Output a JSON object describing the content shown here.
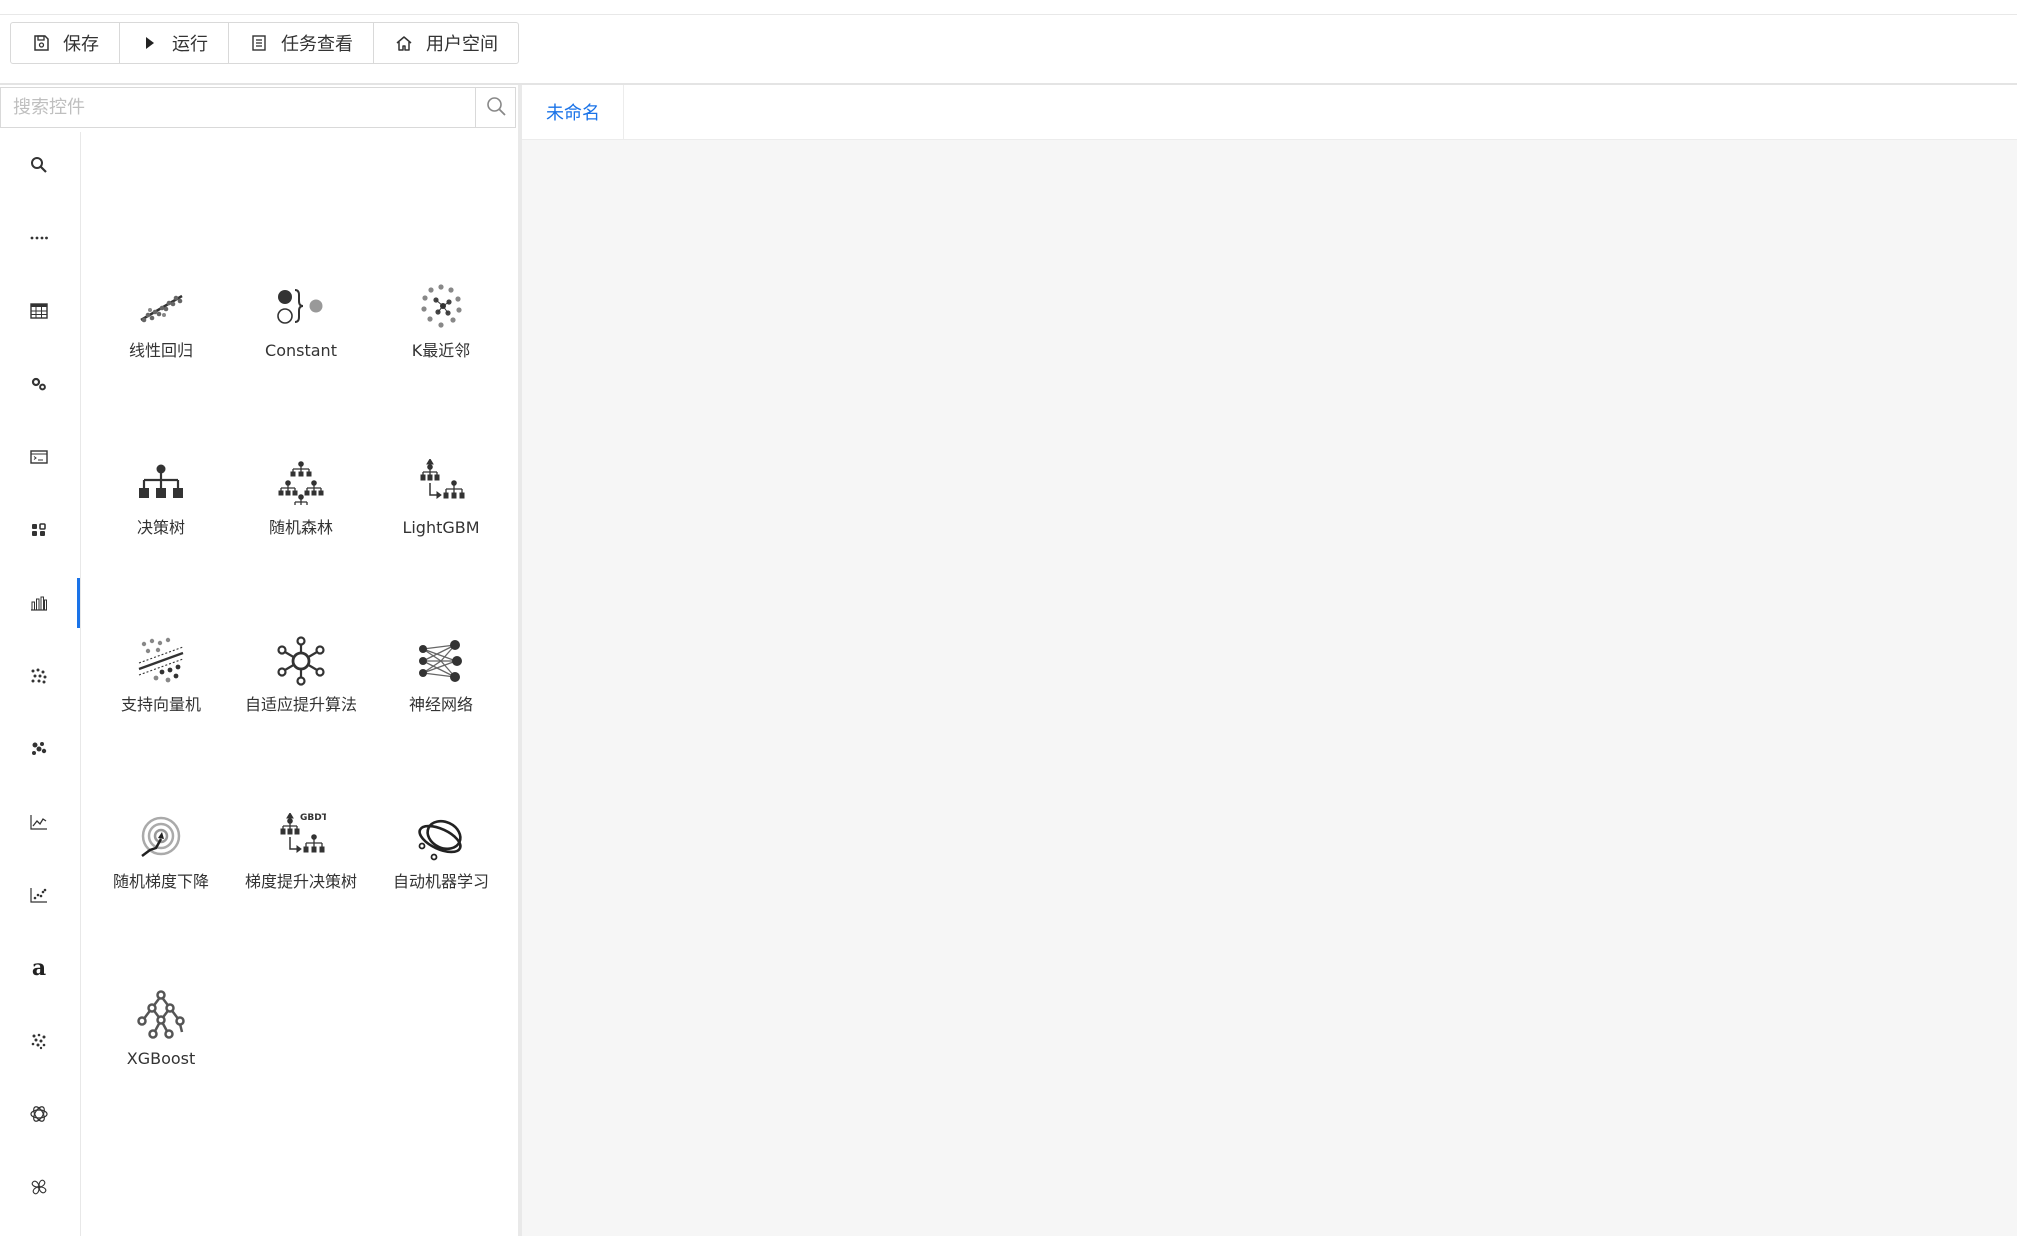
{
  "toolbar": {
    "buttons": [
      {
        "label": "保存",
        "icon": "save-icon"
      },
      {
        "label": "运行",
        "icon": "play-icon"
      },
      {
        "label": "任务查看",
        "icon": "task-list-icon"
      },
      {
        "label": "用户空间",
        "icon": "home-icon"
      }
    ]
  },
  "search": {
    "placeholder": "搜索控件",
    "value": ""
  },
  "categories": [
    "search-icon",
    "dots-icon",
    "table-icon",
    "gears-icon",
    "terminal-icon",
    "components-icon",
    "bar-chart-icon",
    "scatter-dots-icon",
    "cluster-icon",
    "line-chart-icon",
    "scatter-chart-icon",
    "text-a-icon",
    "particles-icon",
    "atom-icon",
    "fan-icon"
  ],
  "active_category_index": 6,
  "widgets": [
    {
      "label": "线性回归",
      "icon": "linear-regression-icon"
    },
    {
      "label": "Constant",
      "icon": "constant-icon"
    },
    {
      "label": "K最近邻",
      "icon": "knn-icon"
    },
    {
      "label": "决策树",
      "icon": "decision-tree-icon"
    },
    {
      "label": "随机森林",
      "icon": "random-forest-icon"
    },
    {
      "label": "LightGBM",
      "icon": "lightgbm-icon"
    },
    {
      "label": "支持向量机",
      "icon": "svm-icon"
    },
    {
      "label": "自适应提升算法",
      "icon": "adaboost-icon"
    },
    {
      "label": "神经网络",
      "icon": "neural-network-icon"
    },
    {
      "label": "随机梯度下降",
      "icon": "sgd-icon"
    },
    {
      "label": "梯度提升决策树",
      "icon": "gbdt-icon"
    },
    {
      "label": "自动机器学习",
      "icon": "automl-icon"
    },
    {
      "label": "XGBoost",
      "icon": "xgboost-icon"
    }
  ],
  "workflow": {
    "tab_label": "未命名"
  },
  "colors": {
    "accent": "#1a73e8",
    "canvas_bg": "#f6f6f6",
    "border": "#d9d9d9"
  }
}
